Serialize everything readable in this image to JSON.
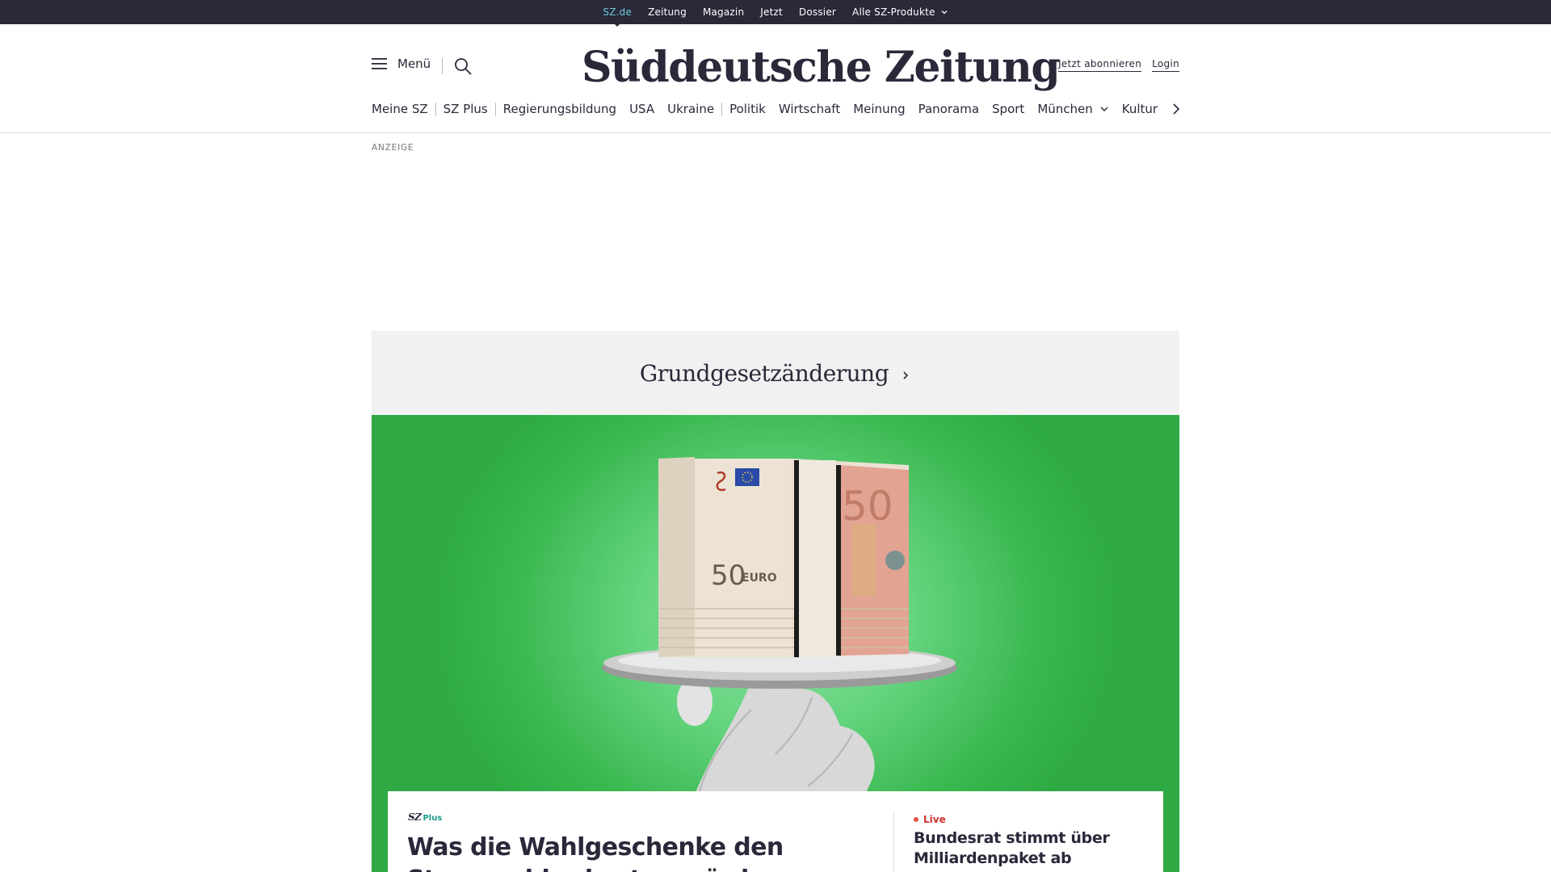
{
  "topbar": {
    "items": [
      {
        "label": "SZ.de",
        "active": true
      },
      {
        "label": "Zeitung"
      },
      {
        "label": "Magazin"
      },
      {
        "label": "Jetzt"
      },
      {
        "label": "Dossier"
      },
      {
        "label": "Alle SZ-Produkte",
        "dropdown": true
      }
    ]
  },
  "header": {
    "menu_label": "Menü",
    "search_icon": "search-icon",
    "logo_text": "Süddeutsche Zeitung",
    "subscribe_label": "Jetzt abonnieren",
    "login_label": "Login"
  },
  "mainnav": {
    "items": [
      "Meine SZ",
      "SZ Plus",
      "Regierungsbildung",
      "USA",
      "Ukraine",
      "Politik",
      "Wirtschaft",
      "Meinung",
      "Panorama",
      "Sport",
      "München",
      "Kultur"
    ],
    "dropdown_item": "München"
  },
  "ad": {
    "label": "ANZEIGE"
  },
  "topic": {
    "label": "Grundgesetzänderung"
  },
  "teaser": {
    "badge_sz": "SZ",
    "badge_plus": "Plus",
    "headline": "Was die Wahlgeschenke den Steuerzahler kosten würden"
  },
  "side_teaser": {
    "live_label": "Live",
    "headline": "Bundesrat stimmt über Milliardenpaket ab"
  },
  "hero_image": {
    "banknote_value": "50",
    "banknote_currency": "EURO"
  },
  "colors": {
    "topbar_bg": "#29293a",
    "active_link": "#71c9d8",
    "hero_green": "#3bb851",
    "live_red": "#d0312d",
    "plus_teal": "#1a9a8a"
  }
}
